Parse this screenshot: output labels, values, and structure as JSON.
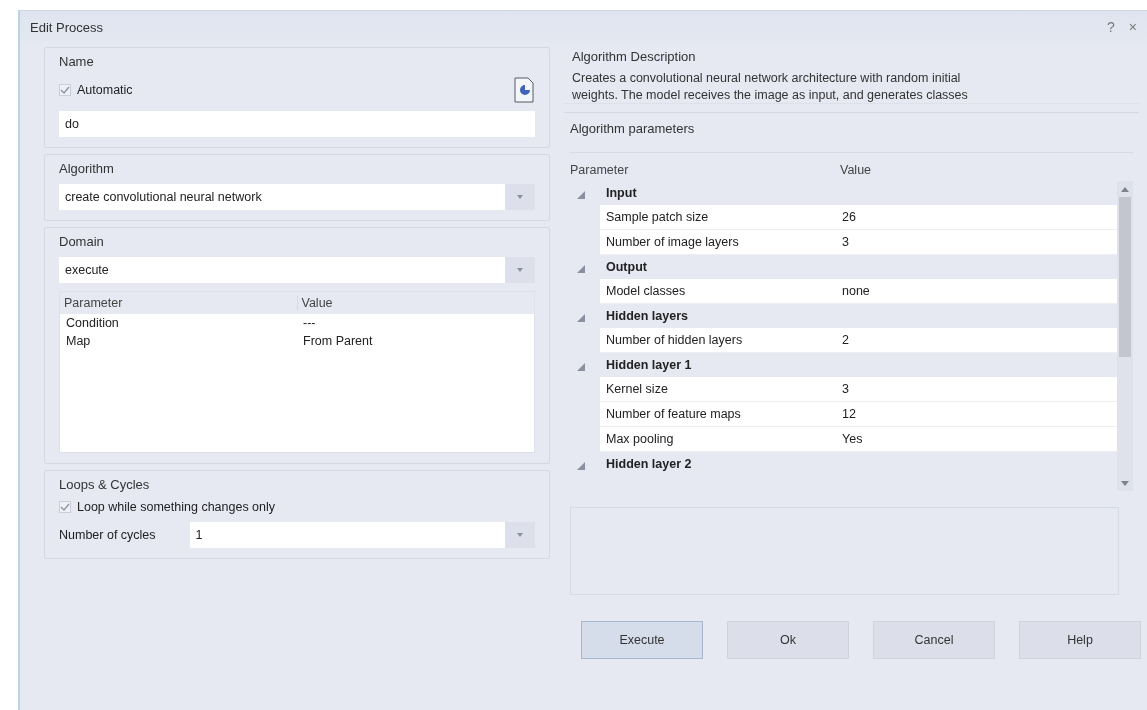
{
  "window": {
    "title": "Edit Process",
    "help": "?",
    "close": "×"
  },
  "name_group": {
    "title": "Name",
    "automatic": {
      "label": "Automatic",
      "checked": true
    },
    "value": "do"
  },
  "algorithm_group": {
    "title": "Algorithm",
    "value": "create convolutional neural network"
  },
  "domain_group": {
    "title": "Domain",
    "value": "execute",
    "columns": [
      "Parameter",
      "Value"
    ],
    "rows": [
      {
        "parameter": "Condition",
        "value": "---"
      },
      {
        "parameter": "Map",
        "value": "From Parent"
      }
    ]
  },
  "loops_group": {
    "title": "Loops & Cycles",
    "loop_only_changes": {
      "label": "Loop while something changes only",
      "checked": true
    },
    "cycles_label": "Number of cycles",
    "cycles_value": "1"
  },
  "description": {
    "title": "Algorithm Description",
    "text": "Creates a convolutional neural network architecture with random initial\nweights. The model receives the image as input, and generates classes"
  },
  "parameters_group": {
    "title": "Algorithm parameters",
    "columns": [
      "Parameter",
      "Value"
    ],
    "categories": [
      {
        "name": "Input",
        "expanded": true,
        "children": [
          {
            "parameter": "Sample patch size",
            "value": "26"
          },
          {
            "parameter": "Number of image layers",
            "value": "3"
          }
        ]
      },
      {
        "name": "Output",
        "expanded": true,
        "children": [
          {
            "parameter": "Model classes",
            "value": "none"
          }
        ]
      },
      {
        "name": "Hidden layers",
        "expanded": true,
        "children": [
          {
            "parameter": "Number of hidden layers",
            "value": "2"
          }
        ]
      },
      {
        "name": "Hidden layer 1",
        "expanded": true,
        "children": [
          {
            "parameter": "Kernel size",
            "value": "3"
          },
          {
            "parameter": "Number of feature maps",
            "value": "12"
          },
          {
            "parameter": "Max pooling",
            "value": "Yes"
          }
        ]
      },
      {
        "name": "Hidden layer 2",
        "expanded": true
      }
    ]
  },
  "buttons": [
    {
      "label": "Execute",
      "selected": true
    },
    {
      "label": "Ok",
      "selected": false
    },
    {
      "label": "Cancel",
      "selected": false
    },
    {
      "label": "Help",
      "selected": false
    }
  ]
}
